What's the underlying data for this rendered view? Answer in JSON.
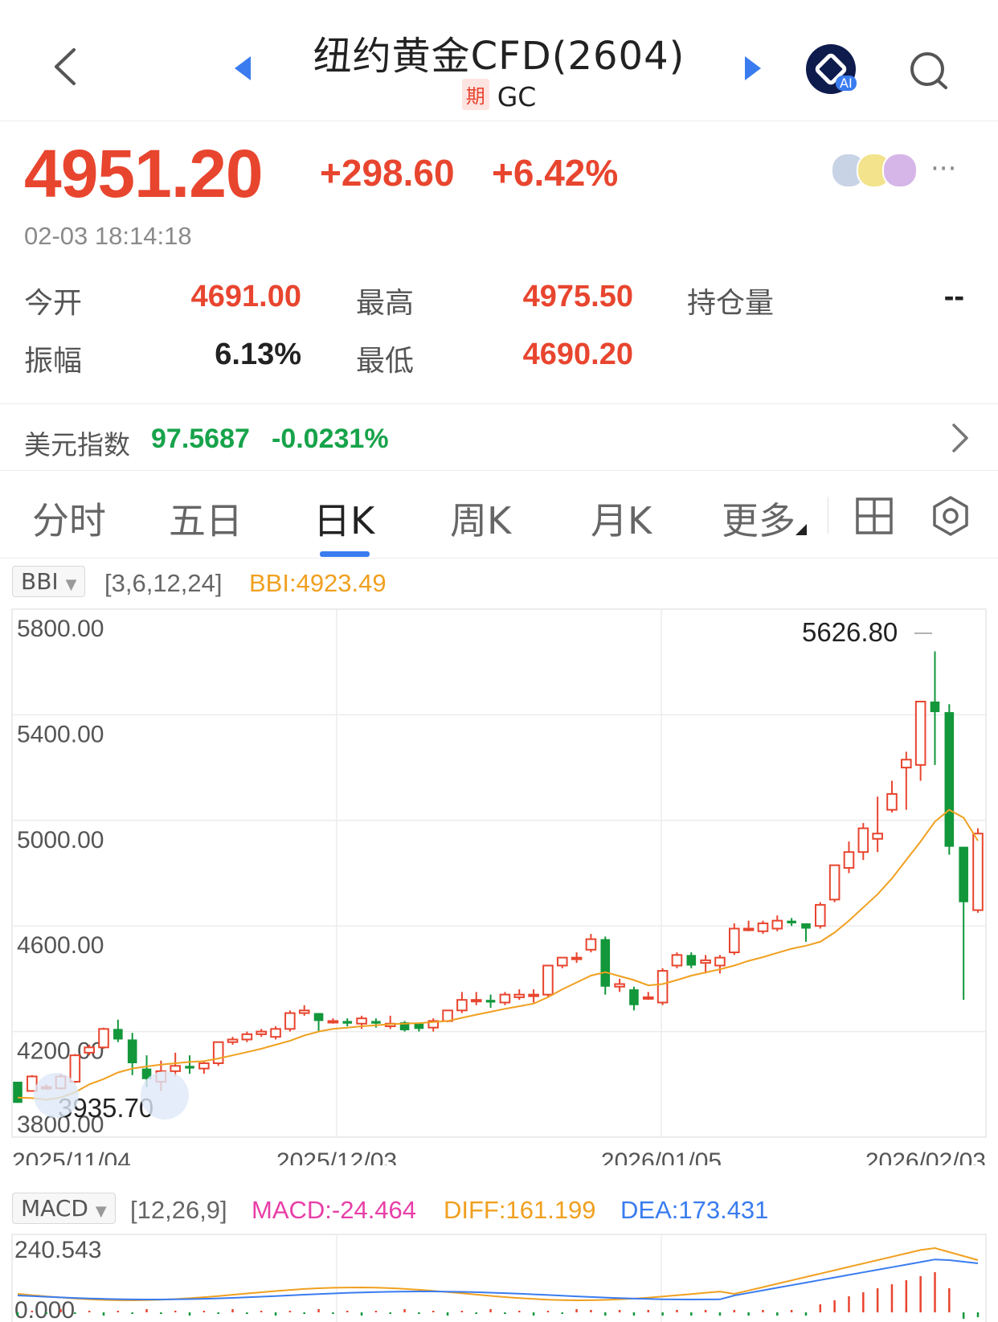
{
  "header": {
    "title": "纽约黄金CFD(2604)",
    "sub_badge": "期",
    "sub_code": "GC",
    "ai_badge": "AI"
  },
  "quote": {
    "price": "4951.20",
    "change": "+298.60",
    "change_pct": "+6.42%",
    "time": "02-03 18:14:18",
    "more": "···"
  },
  "stats": {
    "open_label": "今开",
    "open_value": "4691.00",
    "high_label": "最高",
    "high_value": "4975.50",
    "oi_label": "持仓量",
    "oi_value": "--",
    "amp_label": "振幅",
    "amp_value": "6.13%",
    "low_label": "最低",
    "low_value": "4690.20"
  },
  "usd_index": {
    "label": "美元指数",
    "value": "97.5687",
    "change": "-0.0231%"
  },
  "tabs": [
    "分时",
    "五日",
    "日K",
    "周K",
    "月K",
    "更多"
  ],
  "active_tab": "日K",
  "bbi": {
    "name": "BBI",
    "params": "[3,6,12,24]",
    "value": "BBI:4923.49"
  },
  "macd": {
    "name": "MACD",
    "params": "[12,26,9]",
    "macd": "MACD:-24.464",
    "diff": "DIFF:161.199",
    "dea": "DEA:173.431",
    "ymax": "240.543",
    "zero": "0.000"
  },
  "colors": {
    "up": "#e8452f",
    "down": "#12973a",
    "bbi": "#f0a020",
    "macd": "#e83ea8",
    "diff": "#f0a020",
    "dea": "#3a7cf0"
  },
  "chart_data": {
    "type": "candlestick",
    "y_ticks": [
      "5800.00",
      "5400.00",
      "5000.00",
      "4600.00",
      "4200.00",
      "3800.00"
    ],
    "ylim": [
      3800,
      5800
    ],
    "x_labels": [
      "2025/11/04",
      "2025/12/03",
      "2026/01/05",
      "2026/02/03"
    ],
    "max_label": "5626.80",
    "min_label": "3935.70",
    "candles": [
      [
        4010,
        3930,
        4010,
        3930
      ],
      [
        3975,
        4030,
        4035,
        3975
      ],
      [
        3985,
        3990,
        4000,
        3980
      ],
      [
        3985,
        4030,
        4040,
        3980
      ],
      [
        4010,
        4110,
        4115,
        4005
      ],
      [
        4120,
        4140,
        4150,
        4110
      ],
      [
        4140,
        4210,
        4215,
        4135
      ],
      [
        4210,
        4170,
        4245,
        4160
      ],
      [
        4170,
        4080,
        4195,
        4035
      ],
      [
        4060,
        4020,
        4110,
        3990
      ],
      [
        4010,
        4050,
        4090,
        3975
      ],
      [
        4050,
        4070,
        4120,
        4030
      ],
      [
        4070,
        4060,
        4110,
        4040
      ],
      [
        4060,
        4080,
        4090,
        4040
      ],
      [
        4080,
        4160,
        4160,
        4070
      ],
      [
        4160,
        4170,
        4180,
        4150
      ],
      [
        4170,
        4190,
        4200,
        4160
      ],
      [
        4190,
        4200,
        4210,
        4180
      ],
      [
        4180,
        4210,
        4220,
        4170
      ],
      [
        4210,
        4270,
        4280,
        4200
      ],
      [
        4270,
        4280,
        4300,
        4260
      ],
      [
        4270,
        4240,
        4270,
        4200
      ],
      [
        4240,
        4240,
        4250,
        4230
      ],
      [
        4240,
        4230,
        4250,
        4220
      ],
      [
        4230,
        4250,
        4260,
        4210
      ],
      [
        4240,
        4230,
        4250,
        4215
      ],
      [
        4220,
        4230,
        4260,
        4210
      ],
      [
        4235,
        4205,
        4240,
        4200
      ],
      [
        4230,
        4210,
        4230,
        4200
      ],
      [
        4215,
        4240,
        4250,
        4200
      ],
      [
        4240,
        4280,
        4280,
        4235
      ],
      [
        4280,
        4320,
        4350,
        4270
      ],
      [
        4320,
        4320,
        4350,
        4300
      ],
      [
        4320,
        4310,
        4340,
        4290
      ],
      [
        4310,
        4340,
        4350,
        4300
      ],
      [
        4330,
        4340,
        4360,
        4320
      ],
      [
        4340,
        4340,
        4360,
        4310
      ],
      [
        4340,
        4450,
        4450,
        4330
      ],
      [
        4450,
        4480,
        4480,
        4440
      ],
      [
        4480,
        4480,
        4500,
        4460
      ],
      [
        4510,
        4550,
        4570,
        4500
      ],
      [
        4550,
        4370,
        4560,
        4340
      ],
      [
        4370,
        4380,
        4400,
        4350
      ],
      [
        4360,
        4300,
        4370,
        4280
      ],
      [
        4330,
        4330,
        4350,
        4320
      ],
      [
        4310,
        4430,
        4440,
        4300
      ],
      [
        4450,
        4490,
        4500,
        4440
      ],
      [
        4490,
        4450,
        4500,
        4440
      ],
      [
        4460,
        4470,
        4490,
        4420
      ],
      [
        4450,
        4480,
        4490,
        4420
      ],
      [
        4500,
        4590,
        4610,
        4490
      ],
      [
        4590,
        4590,
        4620,
        4580
      ],
      [
        4580,
        4610,
        4620,
        4570
      ],
      [
        4590,
        4620,
        4640,
        4580
      ],
      [
        4620,
        4610,
        4630,
        4600
      ],
      [
        4610,
        4590,
        4610,
        4540
      ],
      [
        4600,
        4680,
        4690,
        4590
      ],
      [
        4700,
        4830,
        4830,
        4690
      ],
      [
        4820,
        4880,
        4920,
        4800
      ],
      [
        4880,
        4970,
        4990,
        4850
      ],
      [
        4930,
        4950,
        5090,
        4880
      ],
      [
        5040,
        5100,
        5150,
        5030
      ],
      [
        5200,
        5230,
        5260,
        5040
      ],
      [
        5210,
        5450,
        5450,
        5150
      ],
      [
        5450,
        5410,
        5640,
        5210
      ],
      [
        5410,
        4900,
        5440,
        4870
      ],
      [
        4900,
        4690,
        4900,
        4320
      ],
      [
        4660,
        4950,
        4970,
        4650
      ]
    ],
    "bbi_series": [
      3950,
      3948,
      3942,
      3950,
      3970,
      4000,
      4020,
      4045,
      4060,
      4068,
      4075,
      4080,
      4085,
      4088,
      4098,
      4110,
      4122,
      4135,
      4150,
      4165,
      4185,
      4200,
      4210,
      4215,
      4220,
      4224,
      4228,
      4230,
      4232,
      4236,
      4240,
      4252,
      4264,
      4275,
      4286,
      4296,
      4306,
      4330,
      4360,
      4386,
      4412,
      4425,
      4410,
      4395,
      4375,
      4380,
      4395,
      4412,
      4424,
      4436,
      4450,
      4468,
      4482,
      4498,
      4514,
      4525,
      4540,
      4575,
      4620,
      4670,
      4720,
      4780,
      4850,
      4920,
      4995,
      5040,
      5010,
      4923
    ]
  }
}
